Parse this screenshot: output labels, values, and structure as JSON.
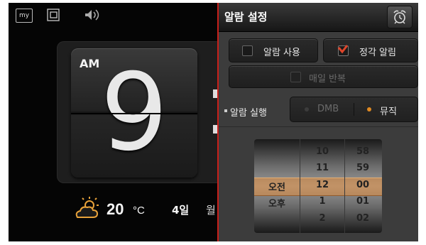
{
  "top_icons": {
    "my_label": "my"
  },
  "clock": {
    "ampm": "AM",
    "hour": "9"
  },
  "weather": {
    "temp": "20",
    "unit": "°C",
    "date": "4일",
    "weekday": "월"
  },
  "panel": {
    "title": "알람 설정",
    "alarm_use": {
      "label": "알람 사용",
      "checked": false
    },
    "hourly_alarm": {
      "label": "정각 알림",
      "checked": true
    },
    "daily_repeat": {
      "label": "매일 반복",
      "checked": false,
      "enabled": false
    },
    "run": {
      "label": "알람 실행",
      "options": [
        {
          "label": "DMB",
          "selected": false
        },
        {
          "label": "뮤직",
          "selected": true
        }
      ]
    },
    "picker": {
      "ampm": [
        "오전",
        "오후"
      ],
      "hours": [
        "10",
        "11",
        "12",
        "1",
        "2"
      ],
      "minutes": [
        "58",
        "59",
        "00",
        "01",
        "02"
      ],
      "selected": {
        "ampm": "오전",
        "hour": "12",
        "minute": "00"
      }
    }
  },
  "colors": {
    "accent": "#c8201b",
    "selection": "#e28c3c",
    "checkmark": "#e0452a"
  }
}
